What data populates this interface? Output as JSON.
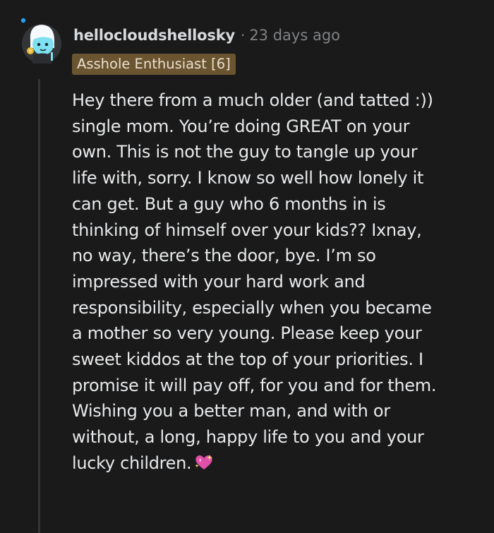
{
  "comment": {
    "username": "hellocloudshellosky",
    "separator": "·",
    "timestamp": "23 days ago",
    "flair": "Asshole Enthusiast [6]",
    "body_lines": [
      "Hey there from a much older (and tatted :))",
      "single mom. You’re doing GREAT on your",
      "own. This is not the guy to tangle up your",
      "life with, sorry. I know so well how lonely it",
      "can get. But a guy who 6 months in is",
      "thinking of himself over your kids?? Ixnay,",
      "no way, there’s the door, bye. I’m so",
      "impressed with your hard work and",
      "responsibility, especially when you became",
      "a mother so very young. Please keep your",
      "sweet kiddos at the top of your priorities. I",
      "promise it will pay off, for you and for them.",
      "Wishing you a better man, and with or",
      "without, a long, happy life to you and your",
      "lucky children."
    ],
    "emoji_icon": "sparkling-heart-icon",
    "colors": {
      "background": "#1a1a1b",
      "text": "#e7e9ea",
      "muted": "#818384",
      "flair_bg": "#6b5530",
      "avatar_accent": "#7ee0f0",
      "heart": "#e04fa8"
    }
  }
}
